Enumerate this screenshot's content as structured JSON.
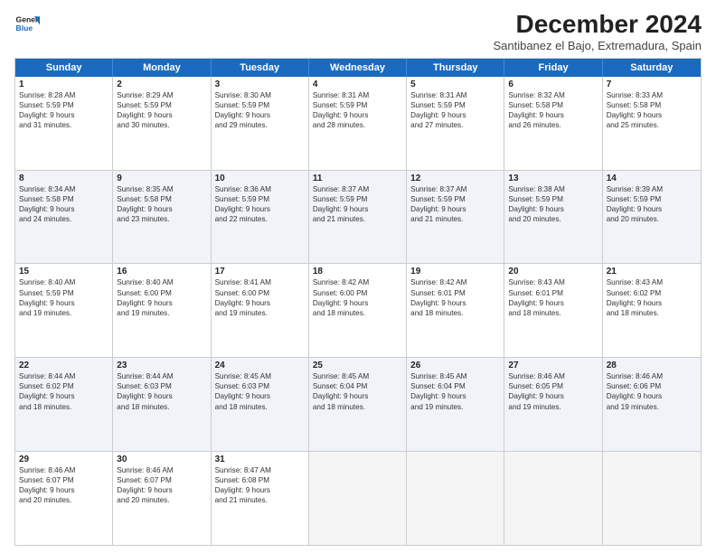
{
  "header": {
    "logo_line1": "General",
    "logo_line2": "Blue",
    "month": "December 2024",
    "location": "Santibanez el Bajo, Extremadura, Spain"
  },
  "days_of_week": [
    "Sunday",
    "Monday",
    "Tuesday",
    "Wednesday",
    "Thursday",
    "Friday",
    "Saturday"
  ],
  "weeks": [
    [
      {
        "day": "1",
        "lines": [
          "Sunrise: 8:28 AM",
          "Sunset: 5:59 PM",
          "Daylight: 9 hours",
          "and 31 minutes."
        ]
      },
      {
        "day": "2",
        "lines": [
          "Sunrise: 8:29 AM",
          "Sunset: 5:59 PM",
          "Daylight: 9 hours",
          "and 30 minutes."
        ]
      },
      {
        "day": "3",
        "lines": [
          "Sunrise: 8:30 AM",
          "Sunset: 5:59 PM",
          "Daylight: 9 hours",
          "and 29 minutes."
        ]
      },
      {
        "day": "4",
        "lines": [
          "Sunrise: 8:31 AM",
          "Sunset: 5:59 PM",
          "Daylight: 9 hours",
          "and 28 minutes."
        ]
      },
      {
        "day": "5",
        "lines": [
          "Sunrise: 8:31 AM",
          "Sunset: 5:59 PM",
          "Daylight: 9 hours",
          "and 27 minutes."
        ]
      },
      {
        "day": "6",
        "lines": [
          "Sunrise: 8:32 AM",
          "Sunset: 5:58 PM",
          "Daylight: 9 hours",
          "and 26 minutes."
        ]
      },
      {
        "day": "7",
        "lines": [
          "Sunrise: 8:33 AM",
          "Sunset: 5:58 PM",
          "Daylight: 9 hours",
          "and 25 minutes."
        ]
      }
    ],
    [
      {
        "day": "8",
        "lines": [
          "Sunrise: 8:34 AM",
          "Sunset: 5:58 PM",
          "Daylight: 9 hours",
          "and 24 minutes."
        ]
      },
      {
        "day": "9",
        "lines": [
          "Sunrise: 8:35 AM",
          "Sunset: 5:58 PM",
          "Daylight: 9 hours",
          "and 23 minutes."
        ]
      },
      {
        "day": "10",
        "lines": [
          "Sunrise: 8:36 AM",
          "Sunset: 5:59 PM",
          "Daylight: 9 hours",
          "and 22 minutes."
        ]
      },
      {
        "day": "11",
        "lines": [
          "Sunrise: 8:37 AM",
          "Sunset: 5:59 PM",
          "Daylight: 9 hours",
          "and 21 minutes."
        ]
      },
      {
        "day": "12",
        "lines": [
          "Sunrise: 8:37 AM",
          "Sunset: 5:59 PM",
          "Daylight: 9 hours",
          "and 21 minutes."
        ]
      },
      {
        "day": "13",
        "lines": [
          "Sunrise: 8:38 AM",
          "Sunset: 5:59 PM",
          "Daylight: 9 hours",
          "and 20 minutes."
        ]
      },
      {
        "day": "14",
        "lines": [
          "Sunrise: 8:39 AM",
          "Sunset: 5:59 PM",
          "Daylight: 9 hours",
          "and 20 minutes."
        ]
      }
    ],
    [
      {
        "day": "15",
        "lines": [
          "Sunrise: 8:40 AM",
          "Sunset: 5:59 PM",
          "Daylight: 9 hours",
          "and 19 minutes."
        ]
      },
      {
        "day": "16",
        "lines": [
          "Sunrise: 8:40 AM",
          "Sunset: 6:00 PM",
          "Daylight: 9 hours",
          "and 19 minutes."
        ]
      },
      {
        "day": "17",
        "lines": [
          "Sunrise: 8:41 AM",
          "Sunset: 6:00 PM",
          "Daylight: 9 hours",
          "and 19 minutes."
        ]
      },
      {
        "day": "18",
        "lines": [
          "Sunrise: 8:42 AM",
          "Sunset: 6:00 PM",
          "Daylight: 9 hours",
          "and 18 minutes."
        ]
      },
      {
        "day": "19",
        "lines": [
          "Sunrise: 8:42 AM",
          "Sunset: 6:01 PM",
          "Daylight: 9 hours",
          "and 18 minutes."
        ]
      },
      {
        "day": "20",
        "lines": [
          "Sunrise: 8:43 AM",
          "Sunset: 6:01 PM",
          "Daylight: 9 hours",
          "and 18 minutes."
        ]
      },
      {
        "day": "21",
        "lines": [
          "Sunrise: 8:43 AM",
          "Sunset: 6:02 PM",
          "Daylight: 9 hours",
          "and 18 minutes."
        ]
      }
    ],
    [
      {
        "day": "22",
        "lines": [
          "Sunrise: 8:44 AM",
          "Sunset: 6:02 PM",
          "Daylight: 9 hours",
          "and 18 minutes."
        ]
      },
      {
        "day": "23",
        "lines": [
          "Sunrise: 8:44 AM",
          "Sunset: 6:03 PM",
          "Daylight: 9 hours",
          "and 18 minutes."
        ]
      },
      {
        "day": "24",
        "lines": [
          "Sunrise: 8:45 AM",
          "Sunset: 6:03 PM",
          "Daylight: 9 hours",
          "and 18 minutes."
        ]
      },
      {
        "day": "25",
        "lines": [
          "Sunrise: 8:45 AM",
          "Sunset: 6:04 PM",
          "Daylight: 9 hours",
          "and 18 minutes."
        ]
      },
      {
        "day": "26",
        "lines": [
          "Sunrise: 8:45 AM",
          "Sunset: 6:04 PM",
          "Daylight: 9 hours",
          "and 19 minutes."
        ]
      },
      {
        "day": "27",
        "lines": [
          "Sunrise: 8:46 AM",
          "Sunset: 6:05 PM",
          "Daylight: 9 hours",
          "and 19 minutes."
        ]
      },
      {
        "day": "28",
        "lines": [
          "Sunrise: 8:46 AM",
          "Sunset: 6:06 PM",
          "Daylight: 9 hours",
          "and 19 minutes."
        ]
      }
    ],
    [
      {
        "day": "29",
        "lines": [
          "Sunrise: 8:46 AM",
          "Sunset: 6:07 PM",
          "Daylight: 9 hours",
          "and 20 minutes."
        ]
      },
      {
        "day": "30",
        "lines": [
          "Sunrise: 8:46 AM",
          "Sunset: 6:07 PM",
          "Daylight: 9 hours",
          "and 20 minutes."
        ]
      },
      {
        "day": "31",
        "lines": [
          "Sunrise: 8:47 AM",
          "Sunset: 6:08 PM",
          "Daylight: 9 hours",
          "and 21 minutes."
        ]
      },
      {
        "day": "",
        "lines": []
      },
      {
        "day": "",
        "lines": []
      },
      {
        "day": "",
        "lines": []
      },
      {
        "day": "",
        "lines": []
      }
    ]
  ]
}
